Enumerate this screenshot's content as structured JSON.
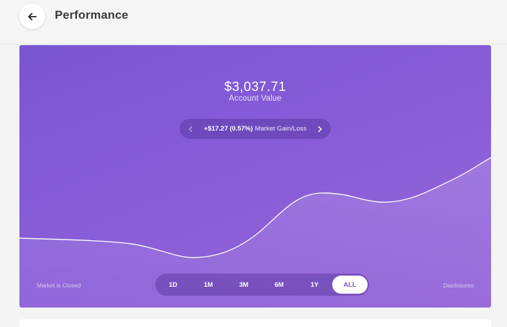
{
  "header": {
    "title": "Performance",
    "back_icon": "arrow-left-icon"
  },
  "account": {
    "value": "$3,037.71",
    "value_label": "Account Value",
    "gain_amount": "+$17.27 (0.57%)",
    "gain_label": "Market Gain/Loss",
    "prev_icon": "chevron-left-icon",
    "next_icon": "chevron-right-icon"
  },
  "footer": {
    "market_status": "Market is Closed",
    "disclosures": "Disclosures"
  },
  "ranges": [
    {
      "label": "1D",
      "active": false
    },
    {
      "label": "1M",
      "active": false
    },
    {
      "label": "3M",
      "active": false
    },
    {
      "label": "6M",
      "active": false
    },
    {
      "label": "1Y",
      "active": false
    },
    {
      "label": "ALL",
      "active": true
    }
  ],
  "colors": {
    "card_start": "#7a55d4",
    "card_end": "#9566d8",
    "active_range_text": "#7a55d4"
  }
}
